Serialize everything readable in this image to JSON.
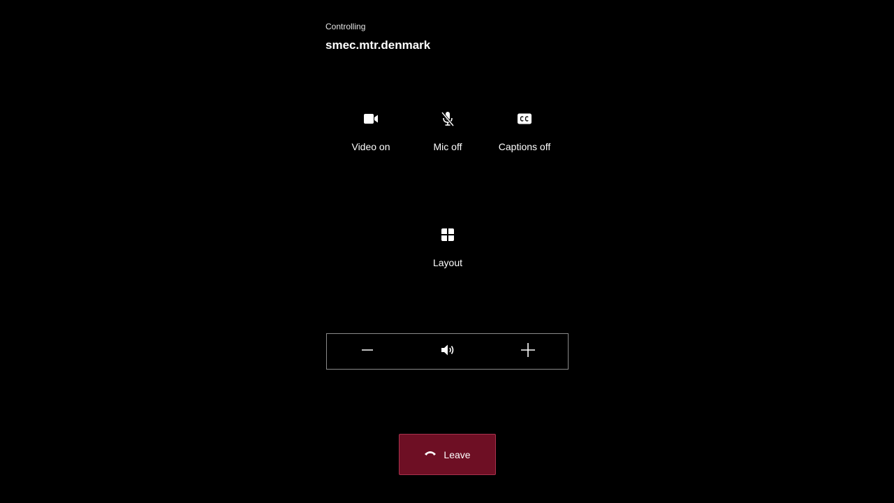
{
  "header": {
    "subtitle": "Controlling",
    "title": "smec.mtr.denmark"
  },
  "controls": {
    "video": {
      "label": "Video on",
      "icon": "video-camera-icon"
    },
    "mic": {
      "label": "Mic off",
      "icon": "mic-off-icon"
    },
    "captions": {
      "label": "Captions off",
      "icon": "closed-captions-icon"
    },
    "layout": {
      "label": "Layout",
      "icon": "layout-grid-icon"
    }
  },
  "volume": {
    "decrease_icon": "minus-icon",
    "speaker_icon": "speaker-volume-icon",
    "increase_icon": "plus-icon"
  },
  "leave": {
    "label": "Leave",
    "icon": "hang-up-icon",
    "color": "#6e0f24"
  },
  "colors": {
    "background": "#000000",
    "text": "#ffffff",
    "leave_button": "#6e0f24"
  }
}
